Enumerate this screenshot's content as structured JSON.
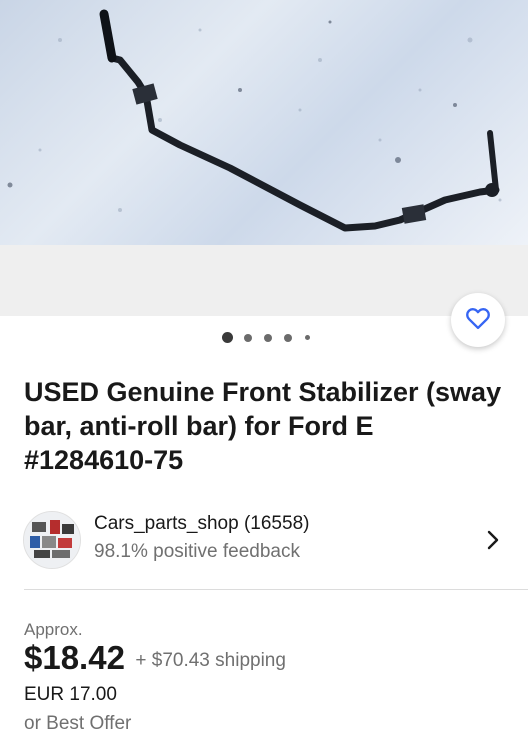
{
  "listing": {
    "title": "USED Genuine Front Stabilizer (sway bar, anti-roll bar) for Ford E #1284610-75",
    "image_alt": "Front stabilizer bar lying on snow",
    "gallery": {
      "total_dots": 5,
      "active_index": 0
    }
  },
  "seller": {
    "name": "Cars_parts_shop (16558)",
    "feedback": "98.1% positive feedback"
  },
  "price": {
    "approx_label": "Approx.",
    "amount": "$18.42",
    "shipping": "+ $70.43 shipping",
    "original": "EUR 17.00",
    "best_offer": "or Best Offer"
  },
  "icons": {
    "favorite": "heart-outline-icon",
    "seller_chevron": "chevron-right-icon"
  },
  "colors": {
    "accent": "#3665f3",
    "text": "#191919",
    "muted": "#707070"
  }
}
